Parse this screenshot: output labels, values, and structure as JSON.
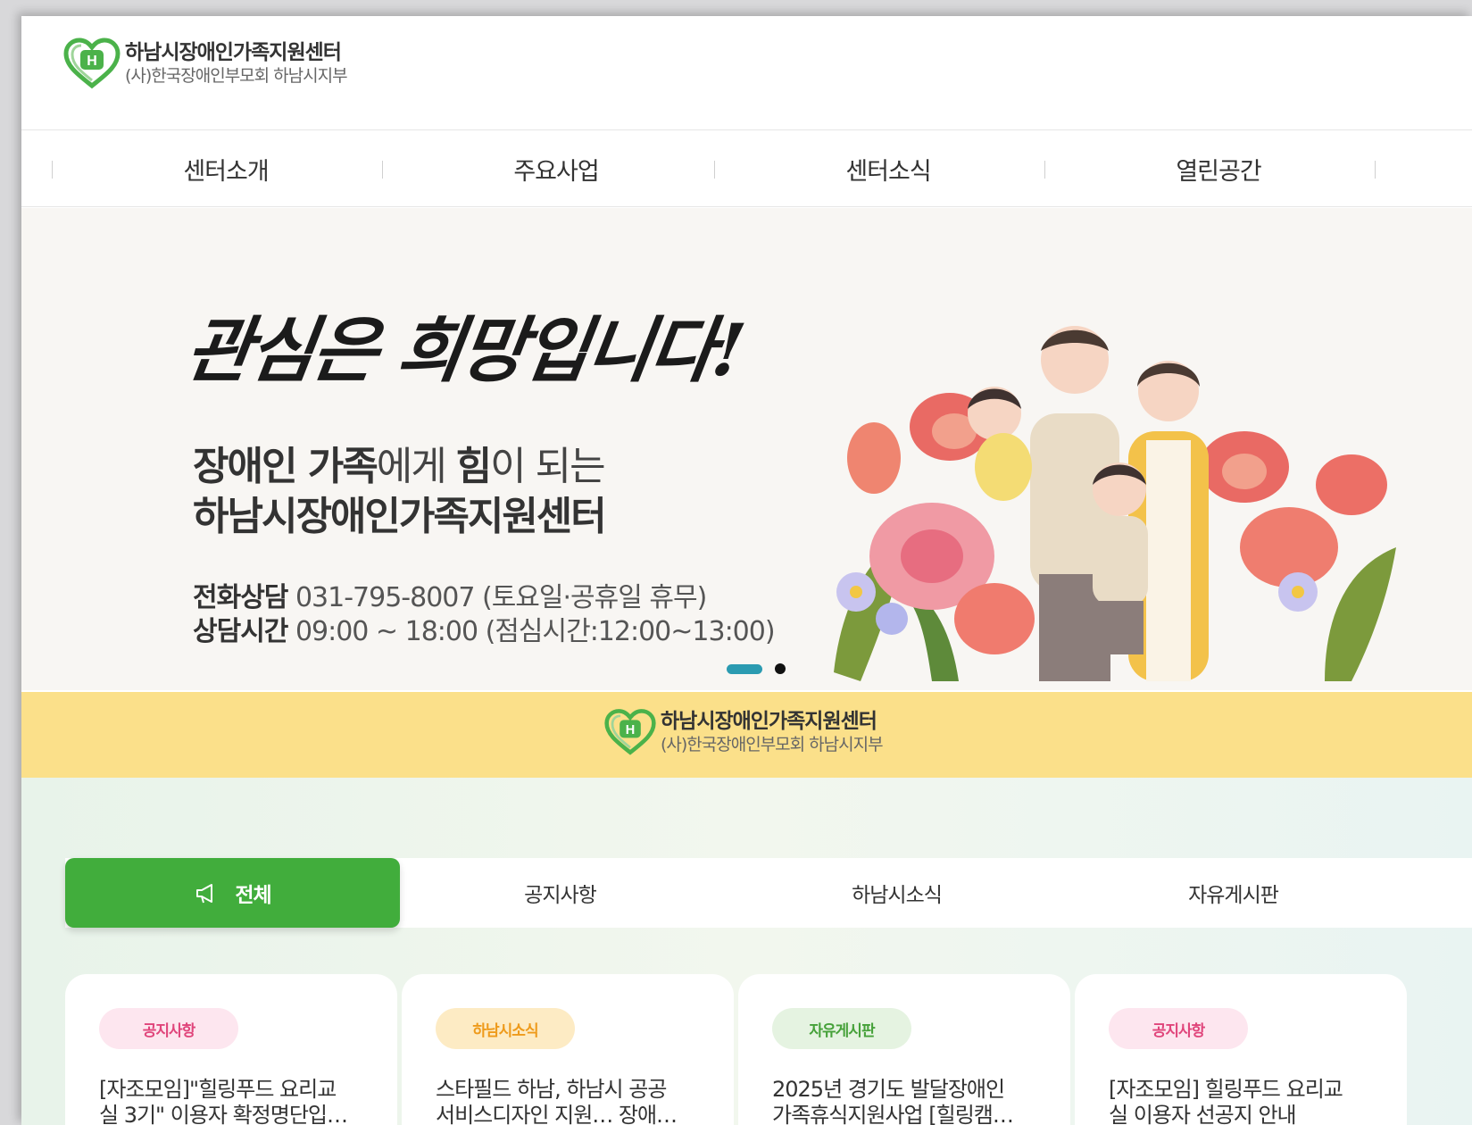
{
  "logo": {
    "title": "하남시장애인가족지원센터",
    "subtitle": "(사)한국장애인부모회 하남시지부"
  },
  "nav": {
    "items": [
      "센터소개",
      "주요사업",
      "센터소식",
      "열린공간"
    ]
  },
  "hero": {
    "slogan": "관심은 희망입니다!",
    "tagline_1_bold_a": "장애인 가족",
    "tagline_1_normal_a": "에게 ",
    "tagline_1_bold_b": "힘",
    "tagline_1_normal_b": "이 되는",
    "tagline_2": "하남시장애인가족지원센터",
    "phone_label": "전화상담",
    "phone_value": " 031-795-8007 (토요일·공휴일 휴무)",
    "hours_label": "상담시간",
    "hours_value": " 09:00 ~ 18:00 (점심시간:12:00~13:00)",
    "slide_count": 2,
    "active_slide": 1
  },
  "band": {
    "title": "하남시장애인가족지원센터",
    "subtitle": "(사)한국장애인부모회 하남시지부"
  },
  "board": {
    "tabs": [
      {
        "label": "전체",
        "icon": "megaphone-icon",
        "active": true
      },
      {
        "label": "공지사항",
        "active": false
      },
      {
        "label": "하남시소식",
        "active": false
      },
      {
        "label": "자유게시판",
        "active": false
      }
    ],
    "cards": [
      {
        "badge": "공지사항",
        "title_line1": "[자조모임]\"힐링푸드 요리교",
        "title_line2": "실 3기\" 이용자 확정명단입…"
      },
      {
        "badge": "하남시소식",
        "title_line1": "스타필드 하남, 하남시 공공",
        "title_line2": "서비스디자인 지원… 장애…"
      },
      {
        "badge": "자유게시판",
        "title_line1": "2025년 경기도 발달장애인",
        "title_line2": "가족휴식지원사업 [힐링캠…"
      },
      {
        "badge": "공지사항",
        "title_line1": "[자조모임] 힐링푸드 요리교",
        "title_line2": "실 이용자 선공지 안내"
      }
    ]
  },
  "colors": {
    "brand_green": "#41ad3c",
    "band_yellow": "#fbe08a",
    "slide_dot": "#2b9bb1"
  }
}
